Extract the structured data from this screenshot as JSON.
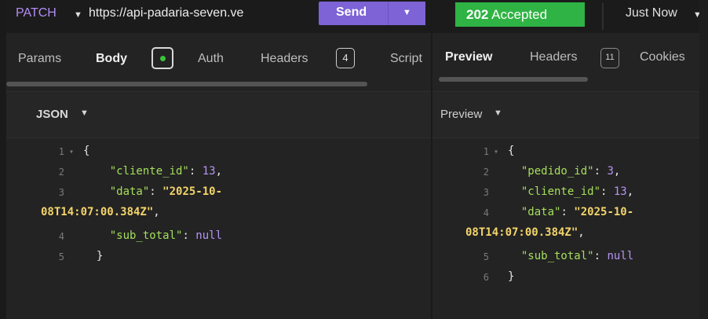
{
  "request": {
    "method": "PATCH",
    "url": "https://api-padaria-seven.ve",
    "send_label": "Send",
    "tabs": [
      {
        "label": "Params"
      },
      {
        "label": "Body"
      },
      {
        "label": "Auth"
      },
      {
        "label": "Headers",
        "count": "4"
      },
      {
        "label": "Script"
      }
    ],
    "body_format": "JSON",
    "body_lines": [
      {
        "n": "1",
        "fold": true,
        "text": "{"
      },
      {
        "n": "2",
        "text": "    \"cliente_id\": 13,"
      },
      {
        "n": "3",
        "text": "    \"data\": \"2025-10-"
      },
      {
        "n": "",
        "text": "08T14:07:00.384Z\","
      },
      {
        "n": "4",
        "text": "    \"sub_total\": null"
      },
      {
        "n": "5",
        "text": "  }"
      }
    ]
  },
  "response": {
    "status_code": "202",
    "status_text": "Accepted",
    "timing": "Just Now",
    "tabs": [
      {
        "label": "Preview"
      },
      {
        "label": "Headers",
        "count": "11"
      },
      {
        "label": "Cookies"
      }
    ],
    "preview_mode": "Preview",
    "body_lines": [
      {
        "n": "1",
        "fold": true,
        "text": "{"
      },
      {
        "n": "2",
        "text": "  \"pedido_id\": 3,"
      },
      {
        "n": "3",
        "text": "  \"cliente_id\": 13,"
      },
      {
        "n": "4",
        "text": "  \"data\": \"2025-10-"
      },
      {
        "n": "",
        "text": "08T14:07:00.384Z\","
      },
      {
        "n": "5",
        "text": "  \"sub_total\": null"
      },
      {
        "n": "6",
        "text": "}"
      }
    ]
  },
  "colors": {
    "send_button": "#7d63d6",
    "status_success": "#2fb344",
    "method": "#b28cf5",
    "json_key": "#a6df5c",
    "json_string": "#f3d46a",
    "json_number": "#b794f6",
    "body_dot": "#3ac43a"
  },
  "icons": {
    "dropdown": "chevron-down-icon",
    "fold": "fold-arrow-icon"
  }
}
